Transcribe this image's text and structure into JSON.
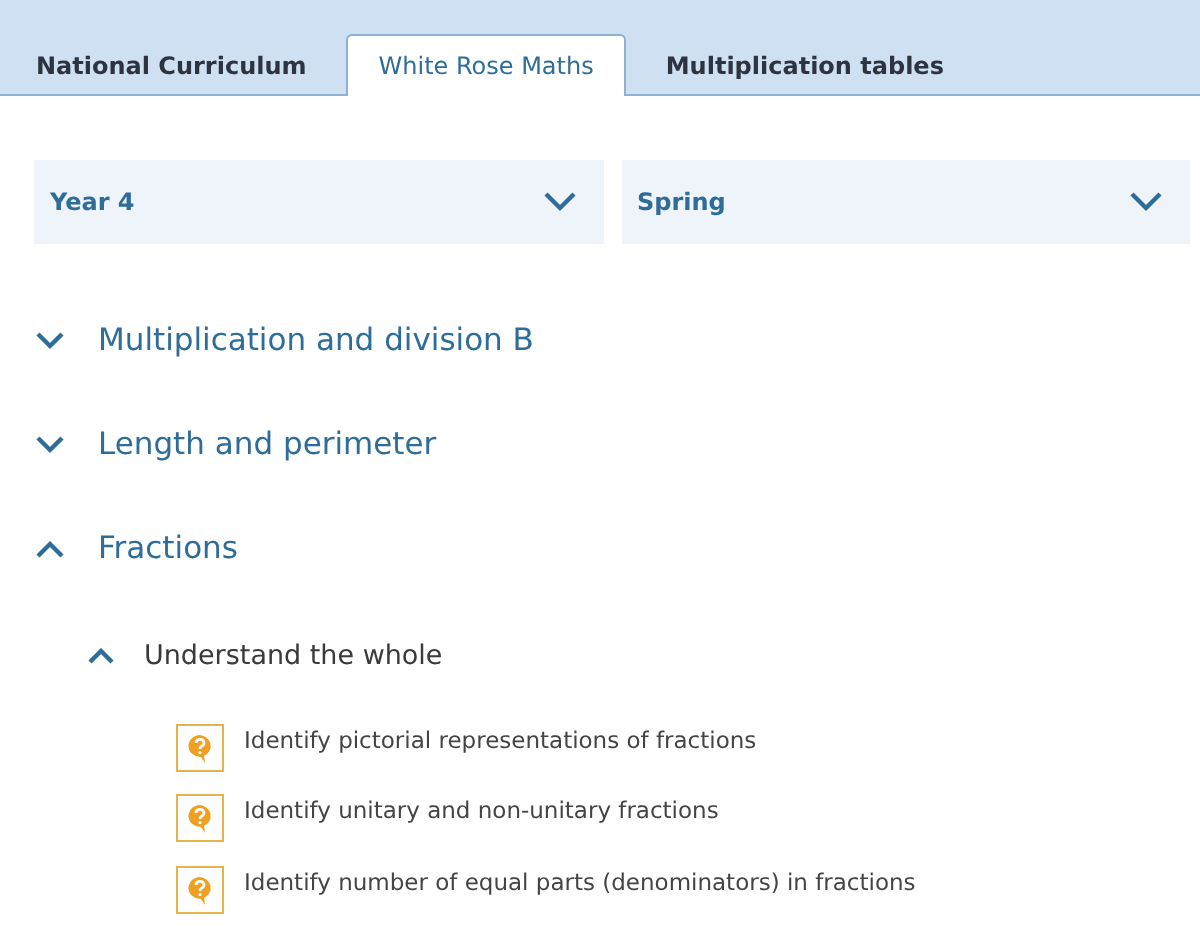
{
  "tabs": [
    {
      "label": "National Curriculum",
      "selected": false
    },
    {
      "label": "White Rose Maths",
      "selected": true
    },
    {
      "label": "Multiplication tables",
      "selected": false
    }
  ],
  "dropdowns": [
    {
      "value": "Year 4"
    },
    {
      "value": "Spring"
    }
  ],
  "topics": [
    {
      "label": "Multiplication and division B",
      "expanded": false
    },
    {
      "label": "Length and perimeter",
      "expanded": false
    },
    {
      "label": "Fractions",
      "expanded": true,
      "children": [
        {
          "label": "Understand the whole",
          "expanded": true,
          "children": [
            {
              "label": "Identify pictorial representations of fractions"
            },
            {
              "label": "Identify unitary and non-unitary fractions"
            },
            {
              "label": "Identify number of equal parts (denominators) in fractions"
            }
          ]
        }
      ]
    }
  ]
}
